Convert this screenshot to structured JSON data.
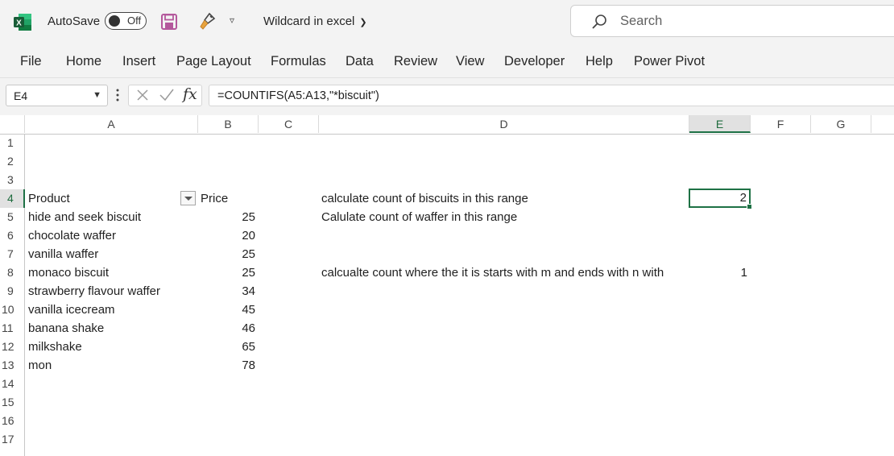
{
  "titlebar": {
    "autosave_label": "AutoSave",
    "autosave_state": "Off",
    "doc_title": "Wildcard in excel",
    "search_placeholder": "Search"
  },
  "ribbon": {
    "tabs": [
      "File",
      "Home",
      "Insert",
      "Page Layout",
      "Formulas",
      "Data",
      "Review",
      "View",
      "Developer",
      "Help",
      "Power Pivot"
    ]
  },
  "formula_bar": {
    "name_box": "E4",
    "formula": "=COUNTIFS(A5:A13,\"*biscuit\")"
  },
  "columns": [
    "A",
    "B",
    "C",
    "D",
    "E",
    "F",
    "G"
  ],
  "selected_column": "E",
  "rows": [
    "1",
    "2",
    "3",
    "4",
    "5",
    "6",
    "7",
    "8",
    "9",
    "10",
    "11",
    "12",
    "13",
    "14",
    "15",
    "16",
    "17"
  ],
  "selected_row": "4",
  "sheet": {
    "header_product": "Product",
    "header_price": "Price",
    "products": [
      {
        "name": "hide and seek biscuit",
        "price": "25"
      },
      {
        "name": "chocolate waffer",
        "price": "20"
      },
      {
        "name": "vanilla waffer",
        "price": "25"
      },
      {
        "name": "monaco biscuit",
        "price": "25"
      },
      {
        "name": "strawberry flavour waffer",
        "price": "34"
      },
      {
        "name": "vanilla icecream",
        "price": "45"
      },
      {
        "name": "banana shake",
        "price": "46"
      },
      {
        "name": "milkshake",
        "price": "65"
      },
      {
        "name": "mon",
        "price": "78"
      }
    ],
    "d4": "calculate count of biscuits in this range",
    "d5": "Calulate count of waffer in this range",
    "d8": "calcualte count where the it is starts with m and ends with n with",
    "e4": "2",
    "e8": "1"
  },
  "colors": {
    "excel_green": "#1e7145",
    "save_purple": "#b4589c"
  }
}
